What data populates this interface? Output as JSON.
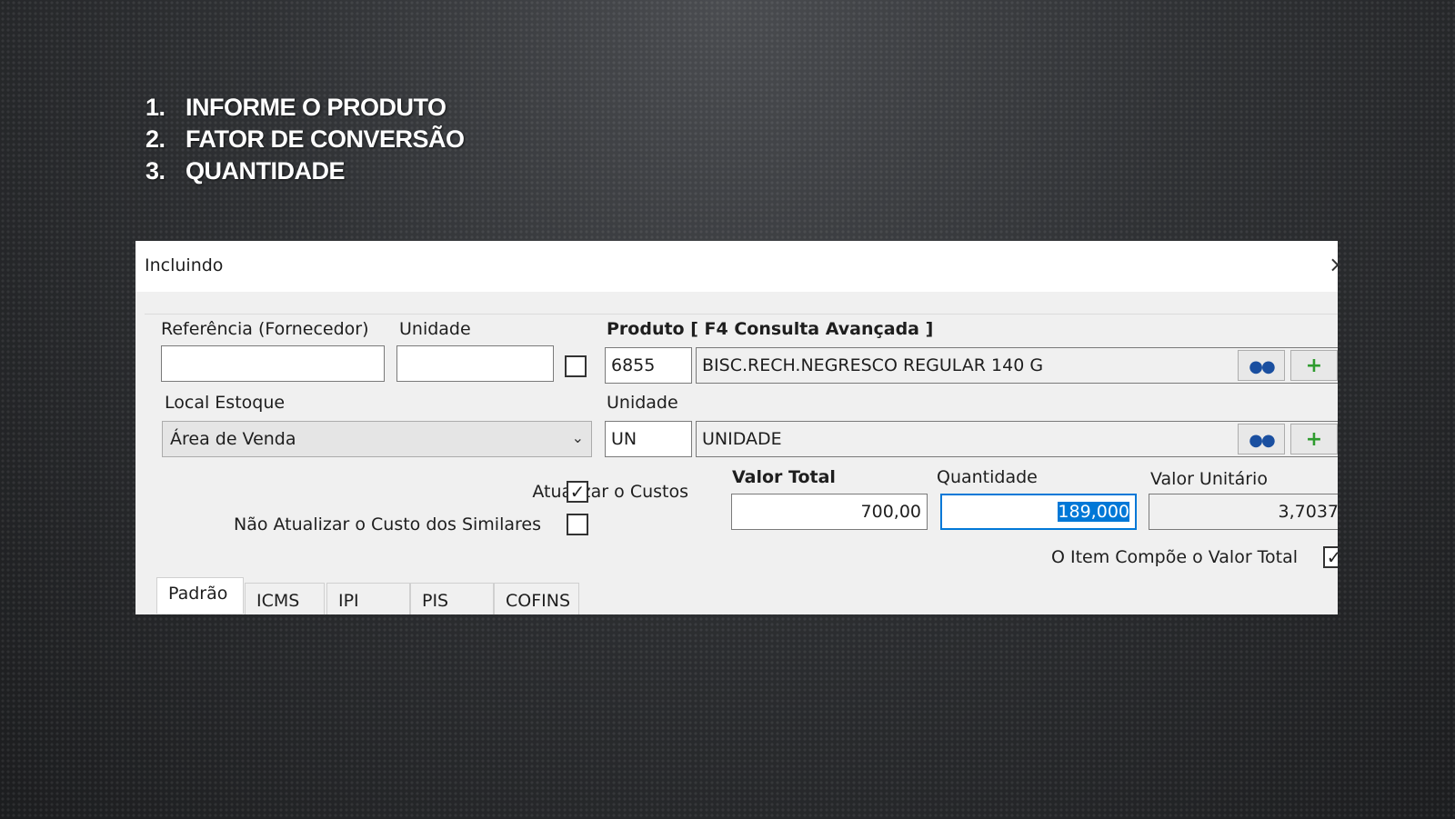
{
  "steps": [
    {
      "num": "1.",
      "text": "INFORME O PRODUTO"
    },
    {
      "num": "2.",
      "text": "FATOR DE CONVERSÃO"
    },
    {
      "num": "3.",
      "text": "QUANTIDADE"
    }
  ],
  "dialog": {
    "title": "Incluindo",
    "close": "×",
    "referencia": {
      "label": "Referência (Fornecedor)",
      "value": ""
    },
    "unidade_top": {
      "label": "Unidade",
      "value": "",
      "checked": false
    },
    "produto": {
      "label": "Produto [ F4 Consulta Avançada ]",
      "code": "6855",
      "description": "BISC.RECH.NEGRESCO REGULAR 140 G"
    },
    "local_estoque": {
      "label": "Local Estoque",
      "value": "Área de Venda"
    },
    "unidade": {
      "label": "Unidade",
      "code": "UN",
      "description": "UNIDADE"
    },
    "atualizar_custos": {
      "label": "Atualizar o Custos",
      "checked": true,
      "mark": "✓"
    },
    "nao_atualizar_similares": {
      "label": "Não Atualizar o Custo dos Similares",
      "checked": false
    },
    "valor_total": {
      "label": "Valor Total",
      "value": "700,00"
    },
    "quantidade": {
      "label": "Quantidade",
      "value": "189,000"
    },
    "valor_unitario": {
      "label": "Valor Unitário",
      "value": "3,7037"
    },
    "item_compoe": {
      "label": "O Item Compõe o Valor Total",
      "checked": true,
      "mark": "✓"
    },
    "tabs": [
      {
        "label": "Padrão",
        "active": true
      },
      {
        "label": "ICMS"
      },
      {
        "label": "IPI"
      },
      {
        "label": "PIS"
      },
      {
        "label": "COFINS"
      }
    ]
  },
  "icons": {
    "search": "binoculars-icon",
    "add": "plus-icon"
  },
  "colors": {
    "accent": "#0078d7",
    "add_icon": "#2e9b2e",
    "search_icon": "#1a4fa0"
  }
}
